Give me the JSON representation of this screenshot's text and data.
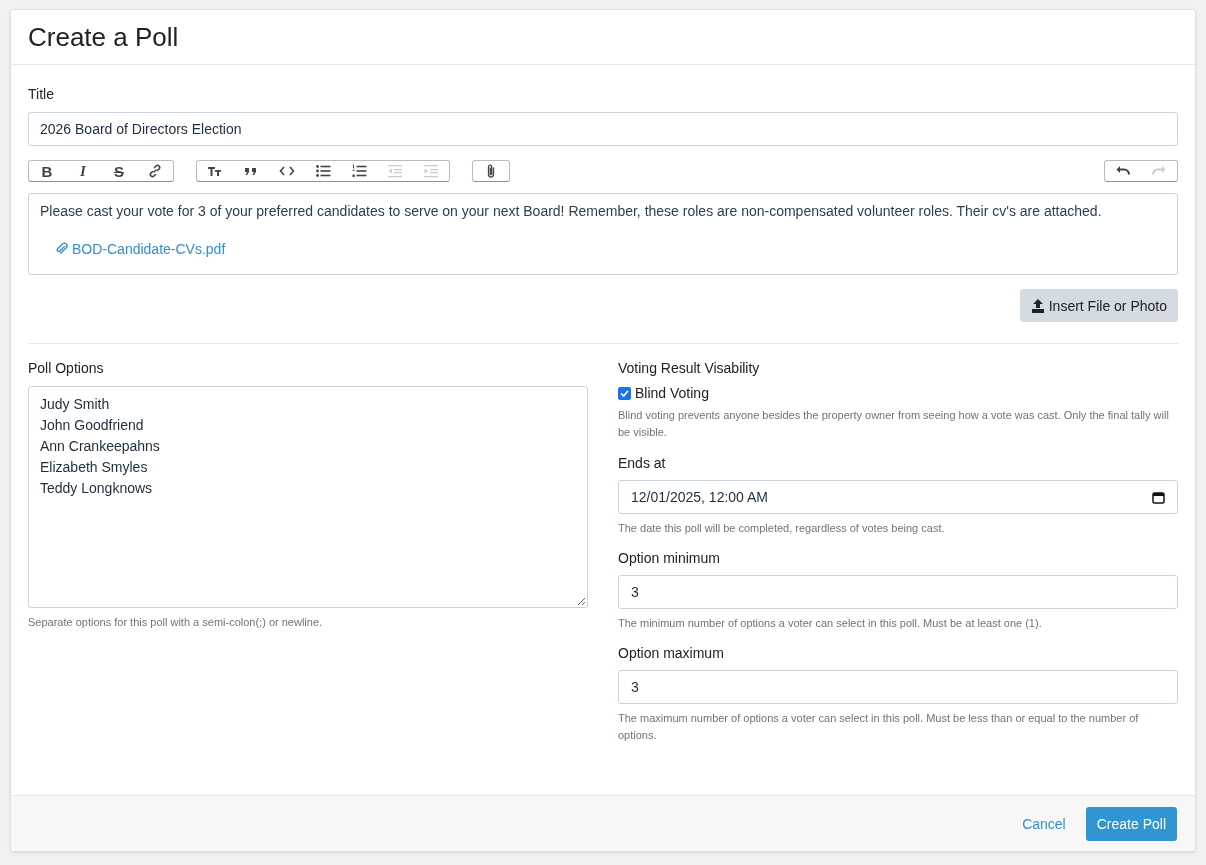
{
  "window": {
    "title": "Create a Poll"
  },
  "title_field": {
    "label": "Title",
    "value": "2026 Board of Directors Election"
  },
  "toolbar": {
    "groups": [
      [
        {
          "kind": "bold",
          "glyph": "B",
          "disabled": false
        },
        {
          "kind": "italic",
          "glyph": "I",
          "disabled": false
        },
        {
          "kind": "strike",
          "glyph": "S",
          "disabled": false
        },
        {
          "kind": "link",
          "disabled": false
        }
      ],
      [
        {
          "kind": "heading",
          "disabled": false
        },
        {
          "kind": "quote",
          "disabled": false
        },
        {
          "kind": "code",
          "disabled": false
        },
        {
          "kind": "bullets",
          "disabled": false
        },
        {
          "kind": "numbers",
          "disabled": false
        },
        {
          "kind": "outdent",
          "disabled": true
        },
        {
          "kind": "indent",
          "disabled": true
        }
      ],
      [
        {
          "kind": "attach",
          "disabled": false
        }
      ]
    ],
    "history": [
      {
        "kind": "undo",
        "disabled": false
      },
      {
        "kind": "redo",
        "disabled": true
      }
    ]
  },
  "editor": {
    "text": "Please cast your vote for 3 of your preferred candidates to serve on your next Board! Remember, these roles are non-compensated volunteer roles. Their cv's are attached.",
    "attachment": "BOD-Candidate-CVs.pdf"
  },
  "insert_button": "Insert File or Photo",
  "poll_options": {
    "label": "Poll Options",
    "lines": [
      "Judy Smith",
      "John Goodfriend",
      "Ann Crankeepahns",
      "Elizabeth Smyles",
      "Teddy Longknows"
    ],
    "help": "Separate options for this poll with a semi-colon(;) or newline."
  },
  "visibility": {
    "label": "Voting Result Visability",
    "checkbox_label": "Blind Voting",
    "checked": true,
    "help": "Blind voting prevents anyone besides the property owner from seeing how a vote was cast. Only the final tally will be visible."
  },
  "fields": [
    {
      "kind": "date",
      "label": "Ends at",
      "value": "12/01/2025, 12:00 AM",
      "help": "The date this poll will be completed, regardless of votes being cast."
    },
    {
      "kind": "number",
      "label": "Option minimum",
      "value": "3",
      "help": "The minimum number of options a voter can select in this poll. Must be at least one (1)."
    },
    {
      "kind": "number",
      "label": "Option maximum",
      "value": "3",
      "help": "The maximum number of options a voter can select in this poll. Must be less than or equal to the number of options."
    }
  ],
  "footer": {
    "cancel": "Cancel",
    "submit": "Create Poll"
  }
}
